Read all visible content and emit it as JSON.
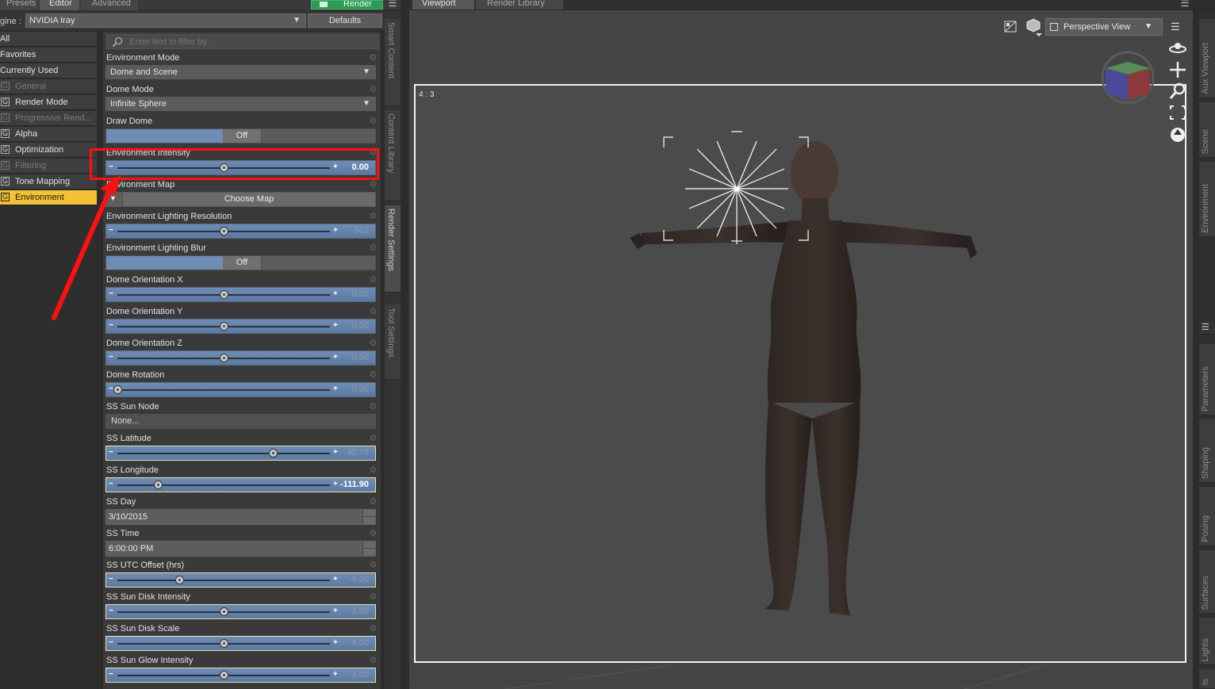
{
  "left_tabs": [
    "Presets",
    "Editor",
    "Advanced"
  ],
  "render_button": "Render",
  "engine": {
    "label": "gine :",
    "value": "NVIDIA Iray",
    "defaults_label": "Defaults"
  },
  "categories": [
    {
      "label": "All",
      "kind": "plain"
    },
    {
      "label": "Favorites",
      "kind": "plain"
    },
    {
      "label": "Currently Used",
      "kind": "plain"
    },
    {
      "label": "General",
      "kind": "dim"
    },
    {
      "label": "Render Mode",
      "kind": "group"
    },
    {
      "label": "Progressive Rend...",
      "kind": "dim"
    },
    {
      "label": "Alpha",
      "kind": "group"
    },
    {
      "label": "Optimization",
      "kind": "group"
    },
    {
      "label": "Filtering",
      "kind": "dim"
    },
    {
      "label": "Tone Mapping",
      "kind": "group"
    },
    {
      "label": "Environment",
      "kind": "selected"
    }
  ],
  "group_letter": "G",
  "filter": {
    "placeholder": "Enter text to filter by..."
  },
  "properties": [
    {
      "label": "Environment Mode",
      "type": "dropdown",
      "value": "Dome and Scene"
    },
    {
      "label": "Dome Mode",
      "type": "dropdown",
      "value": "Infinite Sphere"
    },
    {
      "label": "Draw Dome",
      "type": "toggle",
      "value": "Off"
    },
    {
      "label": "Environment Intensity",
      "type": "slider",
      "value": "0.00",
      "position": 0.5,
      "bright": true
    },
    {
      "label": "Environment Map",
      "type": "map",
      "value": "Choose Map"
    },
    {
      "label": "Environment Lighting Resolution",
      "type": "slider",
      "value": "512",
      "position": 0.5
    },
    {
      "label": "Environment Lighting Blur",
      "type": "toggle",
      "value": "Off"
    },
    {
      "label": "Dome Orientation X",
      "type": "slider",
      "value": "0.00",
      "position": 0.5
    },
    {
      "label": "Dome Orientation Y",
      "type": "slider",
      "value": "0.00",
      "position": 0.5
    },
    {
      "label": "Dome Orientation Z",
      "type": "slider",
      "value": "0.00",
      "position": 0.5
    },
    {
      "label": "Dome Rotation",
      "type": "slider",
      "value": "0.00",
      "position": 0.0
    },
    {
      "label": "SS Sun Node",
      "type": "node",
      "value": "None..."
    },
    {
      "label": "SS Latitude",
      "type": "slider",
      "value": "40.76",
      "position": 0.73,
      "highlight": true
    },
    {
      "label": "SS Longitude",
      "type": "slider",
      "value": "-111.90",
      "position": 0.19,
      "bright": true,
      "highlight": true
    },
    {
      "label": "SS Day",
      "type": "date",
      "value": "3/10/2015"
    },
    {
      "label": "SS Time",
      "type": "date",
      "value": "6:00:00 PM"
    },
    {
      "label": "SS UTC Offset (hrs)",
      "type": "slider",
      "value": "-6.00",
      "position": 0.29,
      "highlight": true
    },
    {
      "label": "SS Sun Disk Intensity",
      "type": "slider",
      "value": "1.00",
      "position": 0.5,
      "highlight": true
    },
    {
      "label": "SS Sun Disk Scale",
      "type": "slider",
      "value": "4.00",
      "position": 0.5,
      "highlight": true
    },
    {
      "label": "SS Sun Glow Intensity",
      "type": "slider",
      "value": "1.00",
      "position": 0.5,
      "highlight": true
    }
  ],
  "left_side_tabs": [
    "Smart Content",
    "Content Library",
    "Render Settings",
    "Tool Settings"
  ],
  "viewport_tabs": [
    "Viewport",
    "Render Library"
  ],
  "viewport": {
    "view_label": "Perspective View",
    "aspect_label": "4 : 3"
  },
  "right_side_tabs": [
    "Aux Viewport",
    "Scene",
    "Environment",
    "Parameters",
    "Shaping",
    "Posing",
    "Surfaces",
    "Lights",
    "ls"
  ],
  "colors": {
    "accent_selected": "#f3c236",
    "render_green": "#2e9a55",
    "annotation_red": "#ff1010",
    "slider_blue": "#6e8cb4"
  }
}
